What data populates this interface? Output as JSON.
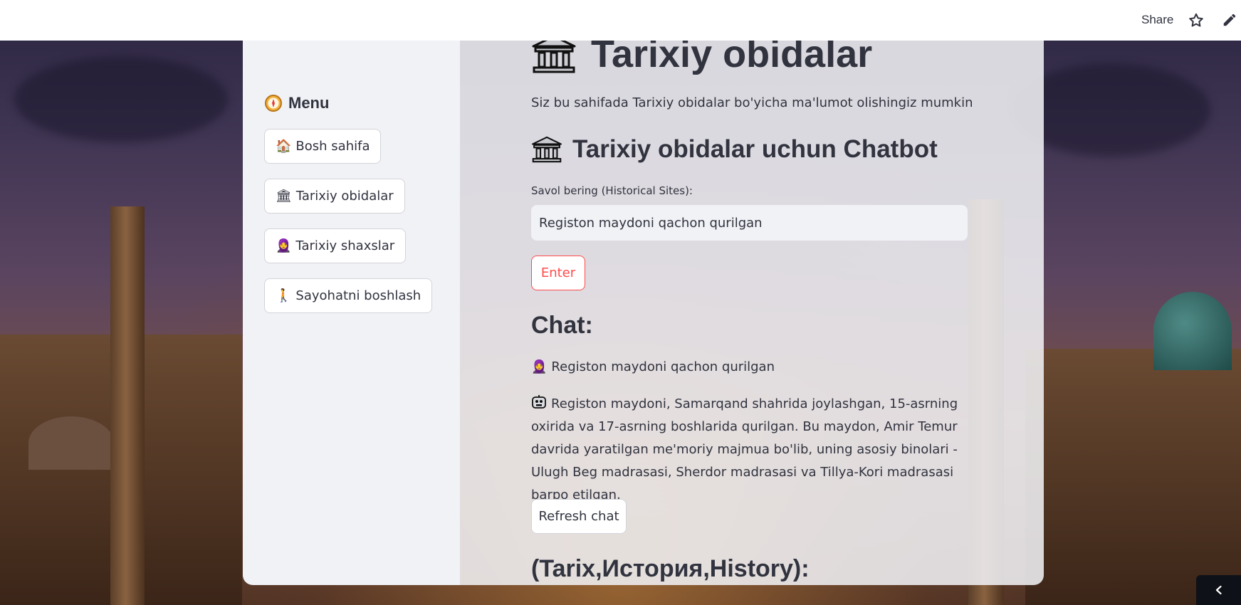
{
  "topbar": {
    "share_label": "Share",
    "star_icon": "star-icon",
    "edit_icon": "pencil-icon"
  },
  "sidebar": {
    "menu_icon": "compass-icon",
    "menu_title": "Menu",
    "items": [
      {
        "icon": "house-icon",
        "emoji": "🏠",
        "label": "Bosh sahifa"
      },
      {
        "icon": "classical-building-icon",
        "emoji": "🏛",
        "label": "Tarixiy obidalar"
      },
      {
        "icon": "person-icon",
        "emoji": "🧕",
        "label": "Tarixiy shaxslar"
      },
      {
        "icon": "walking-person-icon",
        "emoji": "🚶",
        "label": "Sayohatni boshlash"
      }
    ]
  },
  "main": {
    "title_icon": "classical-building-icon",
    "title": "Tarixiy obidalar",
    "subtitle": "Siz bu sahifada Tarixiy obidalar bo'yicha ma'lumot olishingiz mumkin",
    "chatbot_title": "Tarixiy obidalar uchun Chatbot",
    "question_label": "Savol bering (Historical Sites):",
    "question_value": "Registon maydoni qachon qurilgan",
    "enter_label": "Enter",
    "chat_title": "Chat:",
    "user_message": "Registon maydoni qachon qurilgan",
    "bot_message": "Registon maydoni, Samarqand shahrida joylashgan, 15-asrning oxirida va 17-asrning boshlarida qurilgan. Bu maydon, Amir Temur davrida yaratilgan me'moriy majmua bo'lib, uning asosiy binolari - Ulugh Beg madrasasi, Sherdor madrasasi va Tillya-Kori madrasasi barpo etilgan.",
    "refresh_label": "Refresh chat",
    "history_title": "(Tarix,История,History):"
  },
  "colors": {
    "accent": "#ff4b4b",
    "text": "#31333f",
    "sidebar_bg": "#f0f2f6"
  }
}
